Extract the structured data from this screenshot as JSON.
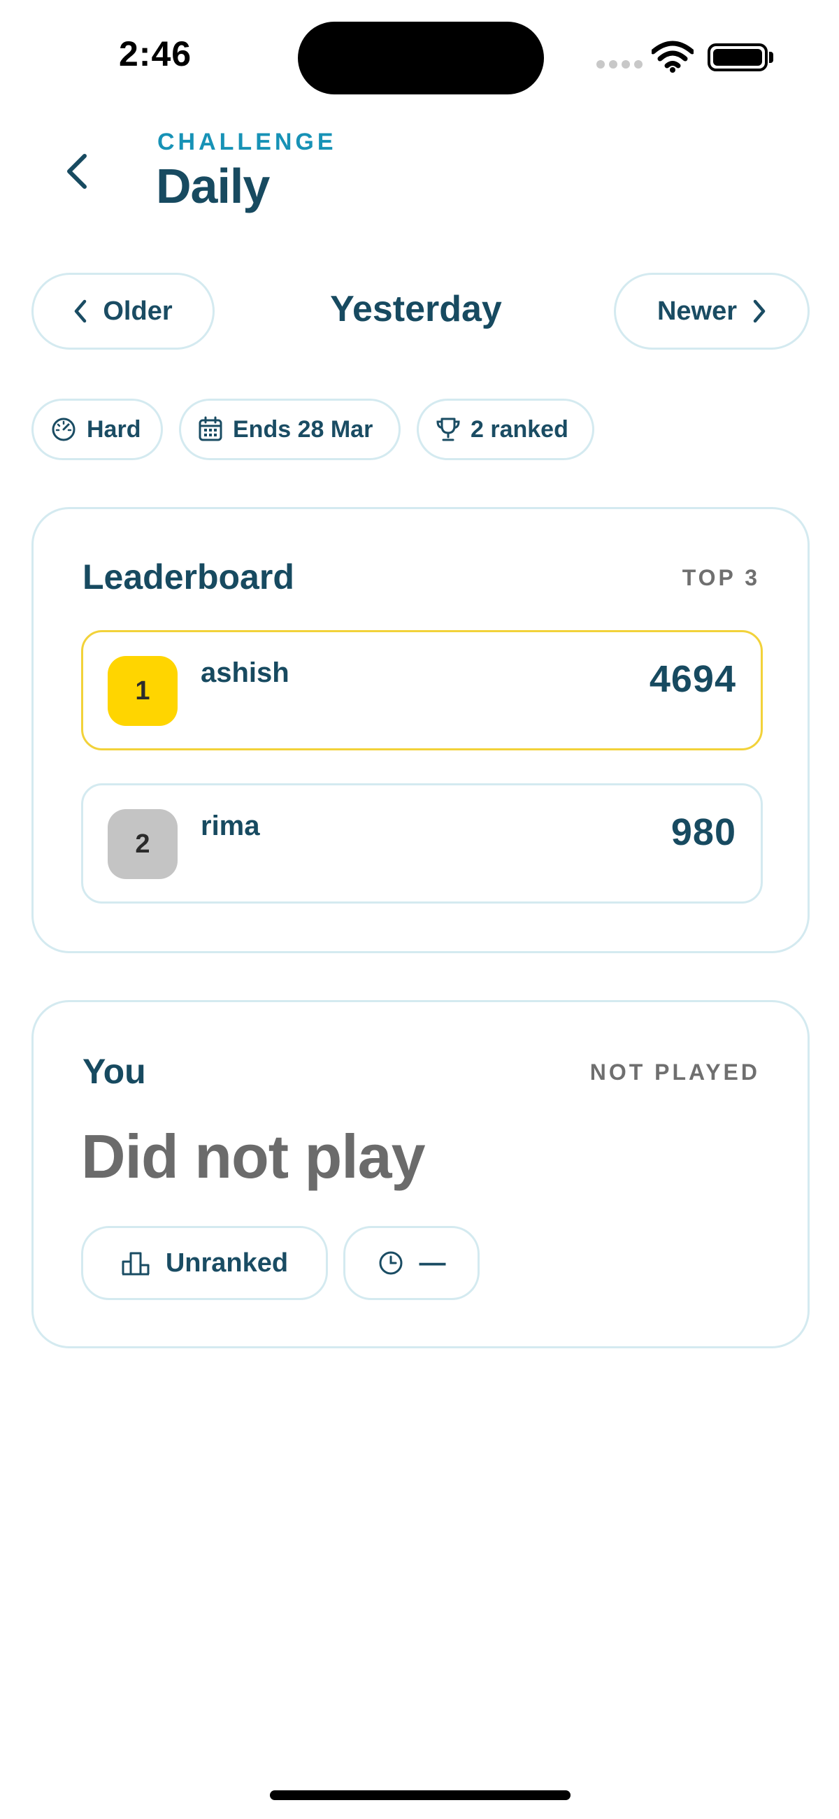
{
  "status_bar": {
    "time": "2:46"
  },
  "header": {
    "eyebrow": "CHALLENGE",
    "title": "Daily"
  },
  "nav": {
    "older_label": "Older",
    "period": "Yesterday",
    "newer_label": "Newer"
  },
  "tags": {
    "difficulty": "Hard",
    "ends": "Ends 28 Mar",
    "ranked": "2 ranked"
  },
  "leaderboard": {
    "title": "Leaderboard",
    "meta": "TOP 3",
    "rows": [
      {
        "rank": "1",
        "name": "ashish",
        "score": "4694",
        "badge_color": "#ffd500"
      },
      {
        "rank": "2",
        "name": "rima",
        "score": "980",
        "badge_color": "#c4c4c4"
      }
    ]
  },
  "you": {
    "title": "You",
    "meta": "NOT PLAYED",
    "status": "Did not play",
    "rank_label": "Unranked",
    "time_label": "—"
  },
  "colors": {
    "accent": "#1792b6",
    "primary_text": "#174a60",
    "border": "#d4eaf0",
    "gold": "#ffd500",
    "silver": "#c4c4c4"
  }
}
